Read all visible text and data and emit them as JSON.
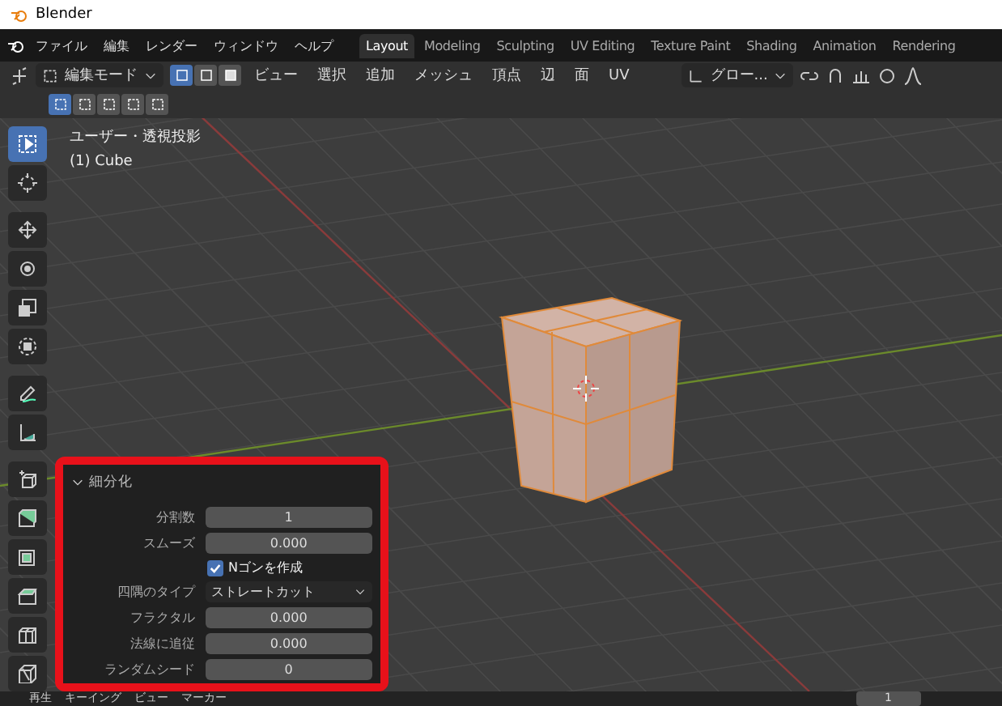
{
  "window": {
    "title": "Blender"
  },
  "menu": [
    "ファイル",
    "編集",
    "レンダー",
    "ウィンドウ",
    "ヘルプ"
  ],
  "workspaces": [
    {
      "label": "Layout",
      "selected": true
    },
    {
      "label": "Modeling",
      "selected": false
    },
    {
      "label": "Sculpting",
      "selected": false
    },
    {
      "label": "UV Editing",
      "selected": false
    },
    {
      "label": "Texture Paint",
      "selected": false
    },
    {
      "label": "Shading",
      "selected": false
    },
    {
      "label": "Animation",
      "selected": false
    },
    {
      "label": "Rendering",
      "selected": false
    }
  ],
  "header": {
    "mode": "編集モード",
    "select_modes": [
      {
        "kind": "vertex",
        "selected": true
      },
      {
        "kind": "edge",
        "selected": false
      },
      {
        "kind": "face",
        "selected": false
      }
    ],
    "menus": [
      "ビュー",
      "選択",
      "追加",
      "メッシュ",
      "頂点",
      "辺",
      "面",
      "UV"
    ],
    "orientation": "グロー..."
  },
  "viewport": {
    "view_name": "ユーザー・透視投影",
    "object": "(1) Cube"
  },
  "tool_groups": [
    [
      {
        "kind": "select",
        "selected": true
      },
      {
        "kind": "cursor",
        "selected": false
      }
    ],
    [
      {
        "kind": "move",
        "selected": false
      },
      {
        "kind": "rotate",
        "selected": false
      },
      {
        "kind": "scale",
        "selected": false
      },
      {
        "kind": "transform",
        "selected": false
      }
    ],
    [
      {
        "kind": "annotate",
        "selected": false
      },
      {
        "kind": "measure",
        "selected": false
      }
    ],
    [
      {
        "kind": "add",
        "selected": false
      },
      {
        "kind": "extrude",
        "selected": false
      },
      {
        "kind": "inset",
        "selected": false
      },
      {
        "kind": "bevel",
        "selected": false
      },
      {
        "kind": "loopcut",
        "selected": false
      },
      {
        "kind": "knife",
        "selected": false
      }
    ]
  ],
  "operator_panel": {
    "title": "細分化",
    "expanded": true,
    "fields": [
      {
        "kind": "number",
        "label": "分割数",
        "value": "1"
      },
      {
        "kind": "number",
        "label": "スムーズ",
        "value": "0.000"
      },
      {
        "kind": "checkbox",
        "label": "Nゴンを作成",
        "checked": true
      },
      {
        "kind": "dropdown",
        "label": "四隅のタイプ",
        "value": "ストレートカット"
      },
      {
        "kind": "number",
        "label": "フラクタル",
        "value": "0.000"
      },
      {
        "kind": "number",
        "label": "法線に追従",
        "value": "0.000"
      },
      {
        "kind": "number",
        "label": "ランダムシード",
        "value": "0"
      }
    ]
  },
  "timeline": {
    "menus": [
      "再生",
      "キーイング",
      "ビュー",
      "マーカー"
    ],
    "frame": "1"
  }
}
